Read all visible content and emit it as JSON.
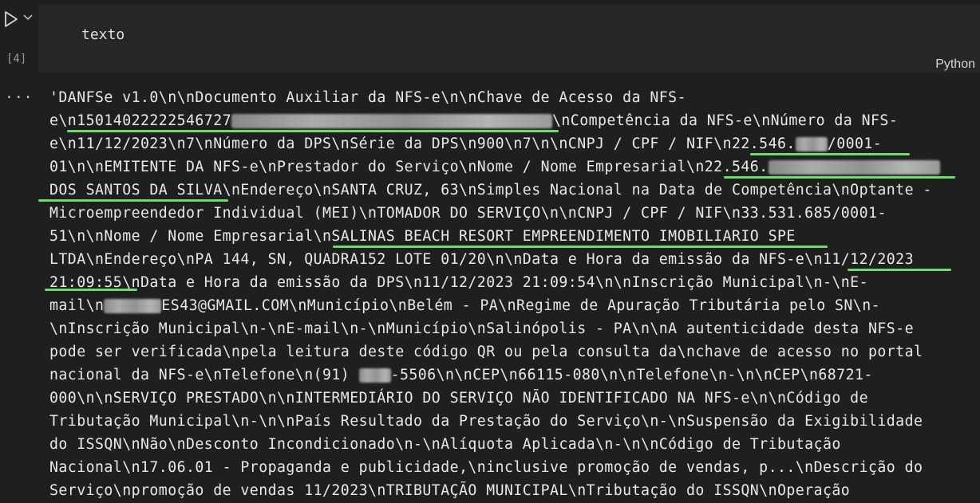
{
  "cell": {
    "execution_count": "[4]",
    "input_code": "texto",
    "language": "Python",
    "output_menu": "..."
  },
  "output": {
    "lines": [
      [
        "'DANFSe v1.0\\n\\nDocumento Auxiliar da NFS-e\\n\\nChave de Acesso da NFS-"
      ],
      [
        "e\\n15014022222546727",
        "\\nCompetência da NFS-e\\nNúmero da NFS-"
      ],
      [
        "e\\n11/12/2023\\n7\\nNúmero da DPS\\nSérie da DPS\\n900\\n7\\n\\nCNPJ / CPF / NIF\\n22.546.",
        "/0001-"
      ],
      [
        "01\\n\\nEMITENTE DA NFS-e\\nPrestador do Serviço\\nNome / Nome Empresarial\\n22.546.",
        ""
      ],
      [
        "DOS SANTOS DA SILVA\\nEndereço\\nSANTA CRUZ, 63\\nSimples Nacional na Data de Competência\\nOptante -"
      ],
      [
        "Microempreendedor Individual (MEI)\\nTOMADOR DO SERVIÇO\\n\\nCNPJ / CPF / NIF\\n33.531.685/0001-"
      ],
      [
        "51\\n\\nNome / Nome Empresarial\\nSALINAS BEACH RESORT EMPREENDIMENTO IMOBILIARIO SPE"
      ],
      [
        "LTDA\\nEndereço\\nPA 144, SN, QUADRA152 LOTE 01/20\\n\\nData e Hora da emissão da NFS-e\\n11/12/2023"
      ],
      [
        "21:09:55\\nData e Hora da emissão da DPS\\n11/12/2023 21:09:54\\n\\nInscrição Municipal\\n-\\nE-"
      ],
      [
        "mail\\n",
        "ES43@GMAIL.COM\\nMunicípio\\nBelém - PA\\nRegime de Apuração Tributária pelo SN\\n-"
      ],
      [
        "\\nInscrição Municipal\\n-\\nE-mail\\n-\\nMunicípio\\nSalinópolis - PA\\n\\nA autenticidade desta NFS-e"
      ],
      [
        "pode ser verificada\\npela leitura deste código QR ou pela consulta da\\nchave de acesso no portal"
      ],
      [
        "nacional da NFS-e\\nTelefone\\n(91) ",
        "-5506\\n\\nCEP\\n66115-080\\n\\nTelefone\\n-\\n\\nCEP\\n68721-"
      ],
      [
        "000\\n\\nSERVIÇO PRESTADO\\n\\nINTERMEDIÁRIO DO SERVIÇO NÃO IDENTIFICADO NA NFS-e\\n\\nCódigo de"
      ],
      [
        "Tributação Municipal\\n-\\n\\nPaís Resultado da Prestação do Serviço\\n-\\nSuspensão da Exigibilidade"
      ],
      [
        "do ISSQN\\nNão\\nDesconto Incondicionado\\n-\\nAlíquota Aplicada\\n-\\n\\nCódigo de Tributação"
      ],
      [
        "Nacional\\n17.06.01 - Propaganda e publicidade,\\ninclusive promoção de vendas, p...\\nDescrição do"
      ],
      [
        "Serviço\\npromoção de vendas 11/2023\\nTRIBUTAÇÃO MUNICIPAL\\nTributação do ISSQN\\nOperação"
      ]
    ]
  },
  "colors": {
    "background": "#1f1f1f",
    "cell_background": "#262626",
    "highlight_underline": "#6dde6d",
    "text": "#e8e8e8"
  }
}
